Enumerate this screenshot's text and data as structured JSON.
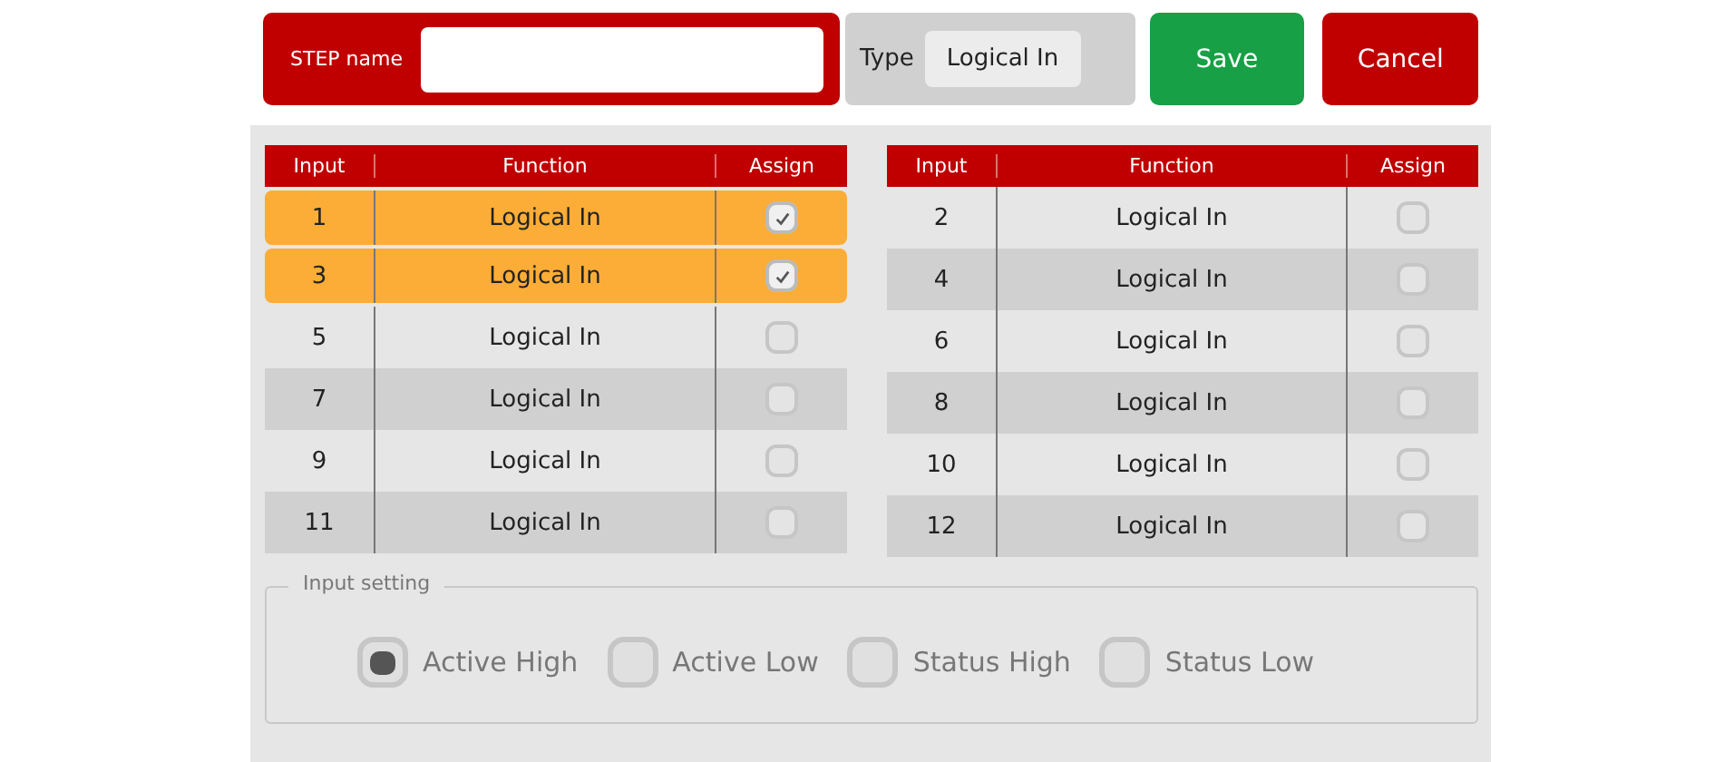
{
  "step_name": {
    "label": "STEP name"
  },
  "type": {
    "label": "Type",
    "value": "Logical In"
  },
  "buttons": [
    {
      "label": "Save",
      "kind": "save"
    },
    {
      "label": "Cancel",
      "kind": "cancel"
    }
  ],
  "tables": [
    {
      "columns": [
        "Input",
        "Function",
        "Assign"
      ],
      "rows": [
        {
          "input": "1",
          "function": "Logical In",
          "checked": true
        },
        {
          "input": "3",
          "function": "Logical In",
          "checked": true
        },
        {
          "input": "5",
          "function": "Logical In",
          "checked": false
        },
        {
          "input": "7",
          "function": "Logical In",
          "checked": false
        },
        {
          "input": "9",
          "function": "Logical In",
          "checked": false
        },
        {
          "input": "11",
          "function": "Logical In",
          "checked": false
        }
      ]
    },
    {
      "columns": [
        "Input",
        "Function",
        "Assign"
      ],
      "rows": [
        {
          "input": "2",
          "function": "Logical In",
          "checked": false
        },
        {
          "input": "4",
          "function": "Logical In",
          "checked": false
        },
        {
          "input": "6",
          "function": "Logical In",
          "checked": false
        },
        {
          "input": "8",
          "function": "Logical In",
          "checked": false
        },
        {
          "input": "10",
          "function": "Logical In",
          "checked": false
        },
        {
          "input": "12",
          "function": "Logical In",
          "checked": false
        }
      ]
    }
  ],
  "input_setting": {
    "legend": "Input setting",
    "options": [
      {
        "label": "Active High",
        "selected": true
      },
      {
        "label": "Active Low",
        "selected": false
      },
      {
        "label": "Status High",
        "selected": false
      },
      {
        "label": "Status Low",
        "selected": false
      }
    ]
  }
}
